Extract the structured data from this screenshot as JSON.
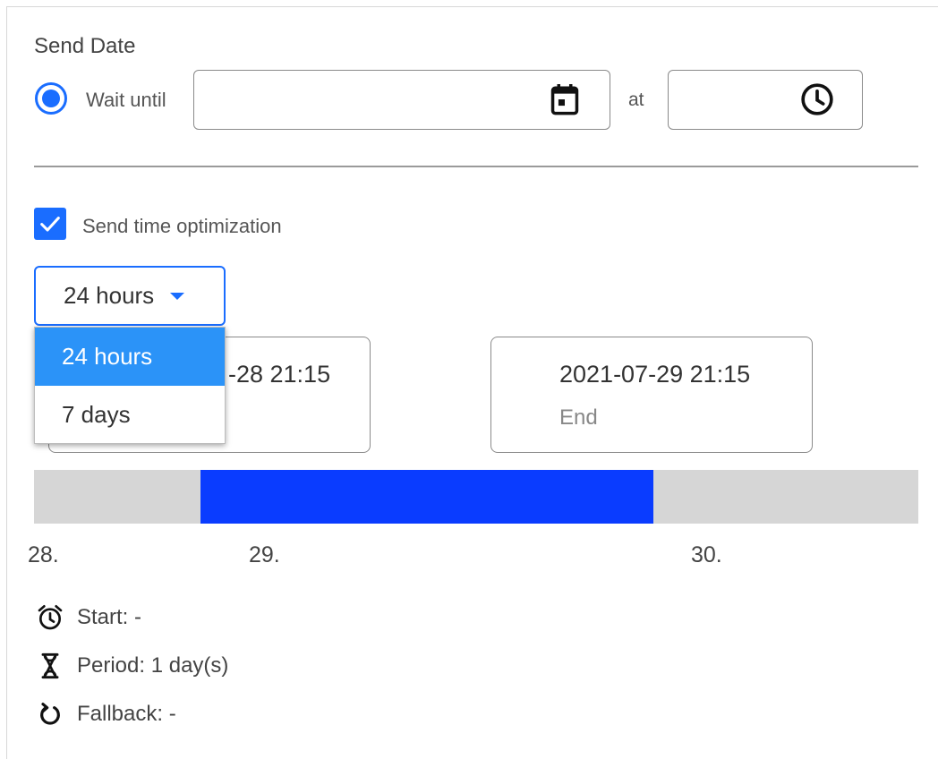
{
  "send_date": {
    "title": "Send Date",
    "radio_label": "Wait until",
    "date_value": "",
    "at_label": "at",
    "time_value": ""
  },
  "optimization": {
    "checkbox_label": "Send time optimization",
    "checked": true,
    "select_value": "24 hours",
    "options": [
      "24 hours",
      "7 days"
    ],
    "active_option": "24 hours"
  },
  "range": {
    "start_value": "2021-07-28 21:15",
    "start_visible_text": "-28 21:15",
    "end_value": "2021-07-29 21:15",
    "end_label": "End"
  },
  "timeline": {
    "ticks": [
      "28.",
      "29.",
      "30."
    ],
    "window_start_fraction": 0.188,
    "window_end_fraction": 0.7,
    "colors": {
      "track": "#d6d6d6",
      "window": "#0a3cff"
    }
  },
  "info": {
    "start": "Start: -",
    "period": "Period: 1 day(s)",
    "fallback": "Fallback: -"
  },
  "colors": {
    "accent": "#1a6dff",
    "dropdown_active": "#2b93f8"
  }
}
